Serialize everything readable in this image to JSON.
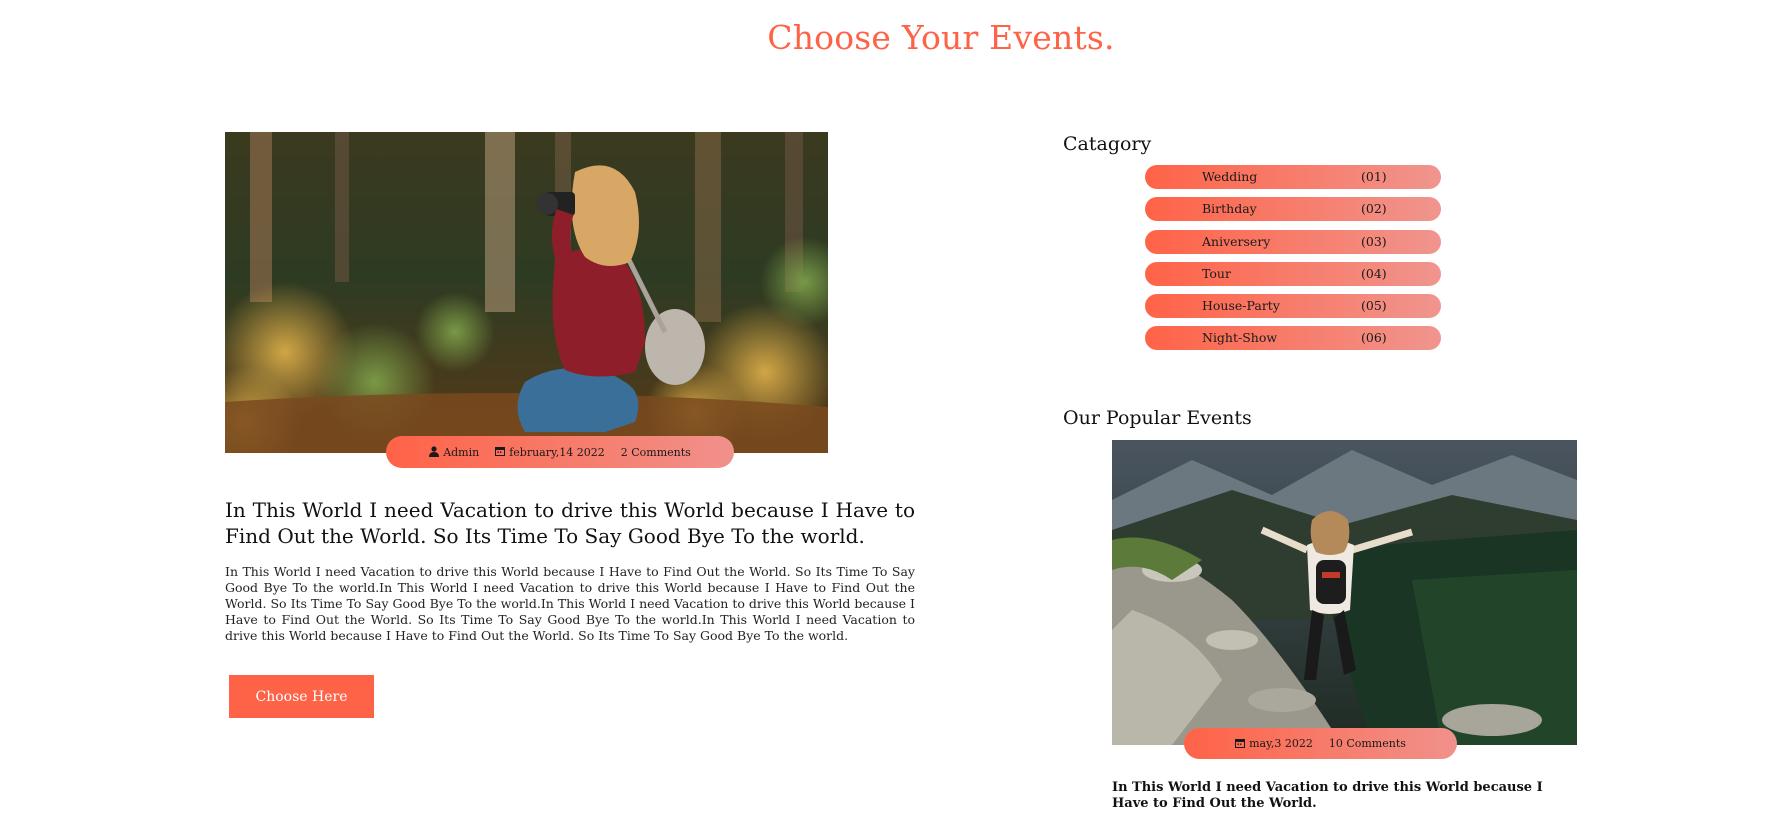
{
  "page": {
    "title": "Choose Your Events."
  },
  "main_post": {
    "image_alt": "Woman photographing in a forest",
    "meta": {
      "author_icon": "user-icon",
      "author": "Admin",
      "date_icon": "calendar-icon",
      "date": "february,14 2022",
      "comments": "2 Comments"
    },
    "heading": "In This World I need Vacation to drive this World because I Have to Find Out the World. So Its Time To Say Good Bye To the world.",
    "body": "In This World I need Vacation to drive this World because I Have to Find Out the World. So Its Time To Say Good Bye To the world.In This World I need Vacation to drive this World because I Have to Find Out the World. So Its Time To Say Good Bye To the world.In This World I need Vacation to drive this World because I Have to Find Out the World. So Its Time To Say Good Bye To the world.In This World I need Vacation to drive this World because I Have to Find Out the World. So Its Time To Say Good Bye To the world.",
    "button_label": "Choose Here"
  },
  "sidebar": {
    "category_title": "Catagory",
    "categories": [
      {
        "name": "Wedding",
        "count": "(01)"
      },
      {
        "name": "Birthday",
        "count": "(02)"
      },
      {
        "name": "Aniversery",
        "count": "(03)"
      },
      {
        "name": "Tour",
        "count": "(04)"
      },
      {
        "name": "House-Party",
        "count": "(05)"
      },
      {
        "name": "Night-Show",
        "count": "(06)"
      }
    ],
    "popular_title": "Our Popular Events",
    "popular_post": {
      "image_alt": "Woman hiking down a rocky mountain trail",
      "meta": {
        "date_icon": "calendar-icon",
        "date": "may,3 2022",
        "comments": "10 Comments"
      },
      "heading": "In This World I need Vacation to drive this World because I Have to Find Out the World."
    }
  },
  "colors": {
    "accent": "#ff6347",
    "accent_light": "#f0918b"
  }
}
